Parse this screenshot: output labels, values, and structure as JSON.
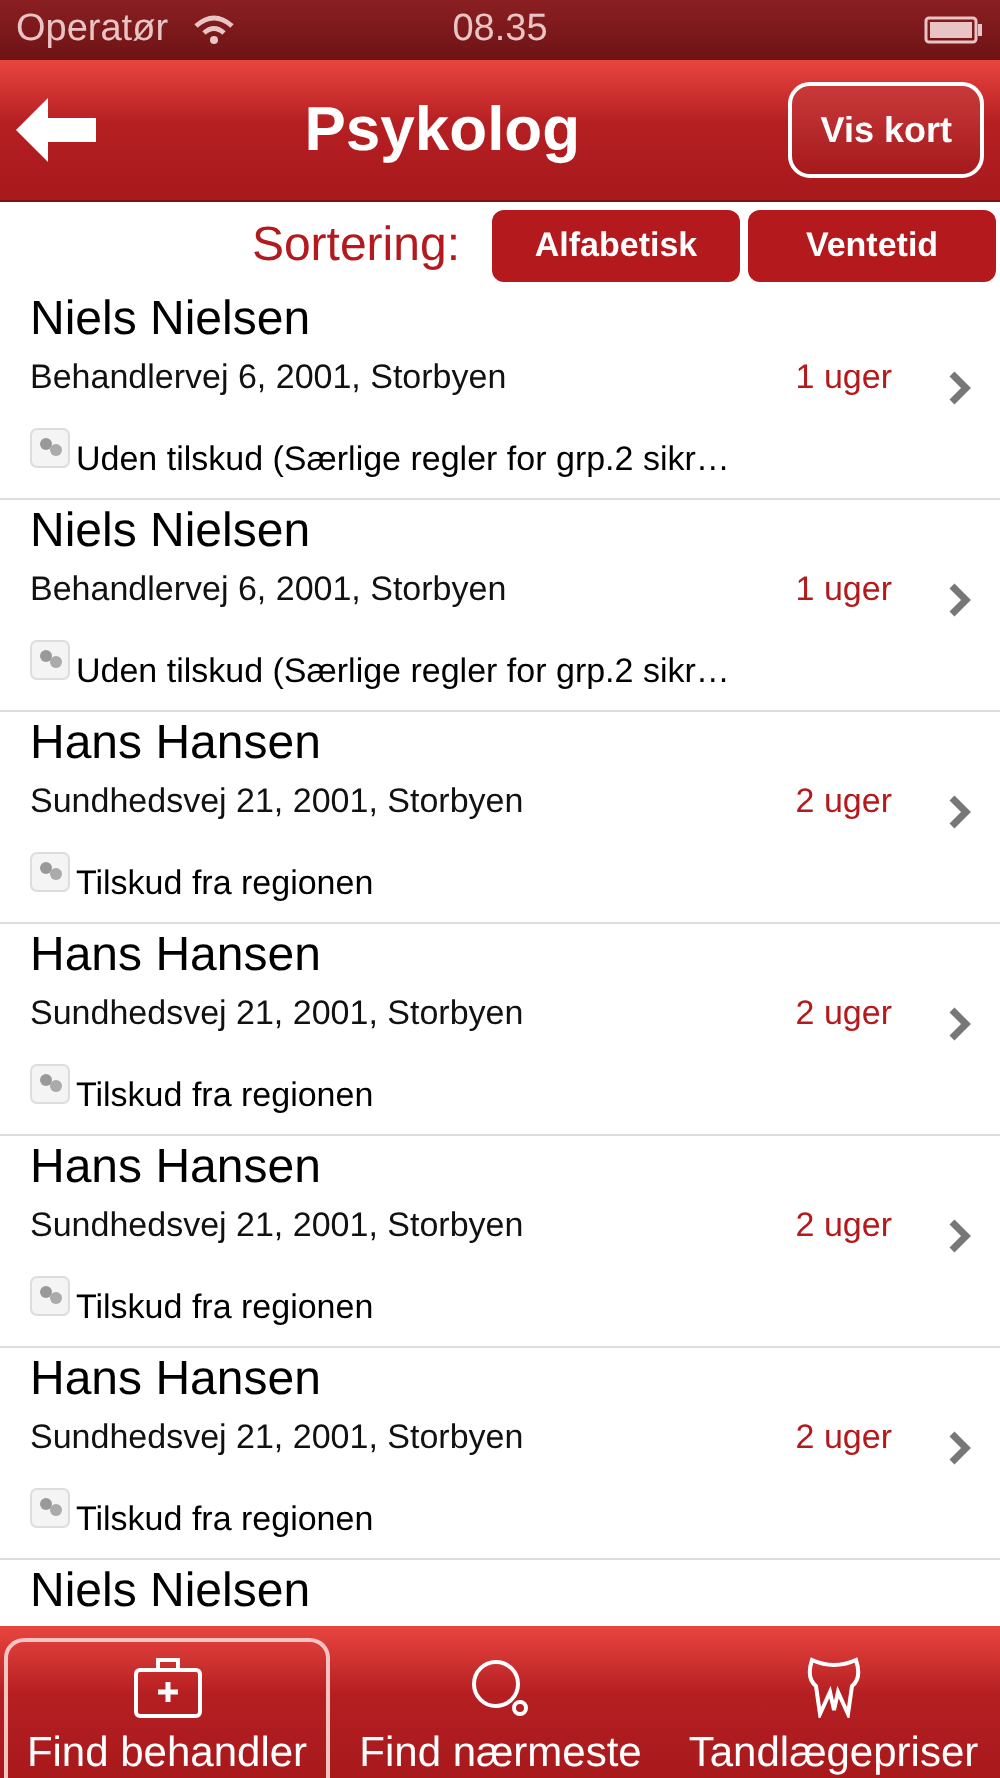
{
  "status_bar": {
    "carrier": "Operatør",
    "time": "08.35"
  },
  "nav": {
    "title": "Psykolog",
    "action": "Vis kort"
  },
  "sort": {
    "label": "Sortering:",
    "options": [
      "Alfabetisk",
      "Ventetid"
    ]
  },
  "rows": [
    {
      "name": "Niels Nielsen",
      "address": "Behandlervej 6, 2001, Storbyen",
      "wait": "1 uger",
      "subsidy": "Uden tilskud (Særlige regler for grp.2 sikr…"
    },
    {
      "name": "Niels Nielsen",
      "address": "Behandlervej 6, 2001, Storbyen",
      "wait": "1 uger",
      "subsidy": "Uden tilskud (Særlige regler for grp.2 sikr…"
    },
    {
      "name": "Hans Hansen",
      "address": "Sundhedsvej 21, 2001, Storbyen",
      "wait": "2 uger",
      "subsidy": "Tilskud fra regionen"
    },
    {
      "name": "Hans Hansen",
      "address": "Sundhedsvej 21, 2001, Storbyen",
      "wait": "2 uger",
      "subsidy": "Tilskud fra regionen"
    },
    {
      "name": "Hans Hansen",
      "address": "Sundhedsvej 21, 2001, Storbyen",
      "wait": "2 uger",
      "subsidy": "Tilskud fra regionen"
    },
    {
      "name": "Hans Hansen",
      "address": "Sundhedsvej 21, 2001, Storbyen",
      "wait": "2 uger",
      "subsidy": "Tilskud fra regionen"
    },
    {
      "name": "Niels Nielsen"
    }
  ],
  "tabs": [
    {
      "label": "Find behandler",
      "kind": "kit",
      "selected": true
    },
    {
      "label": "Find nærmeste",
      "kind": "search",
      "selected": false
    },
    {
      "label": "Tandlægepriser",
      "kind": "tooth",
      "selected": false
    }
  ]
}
